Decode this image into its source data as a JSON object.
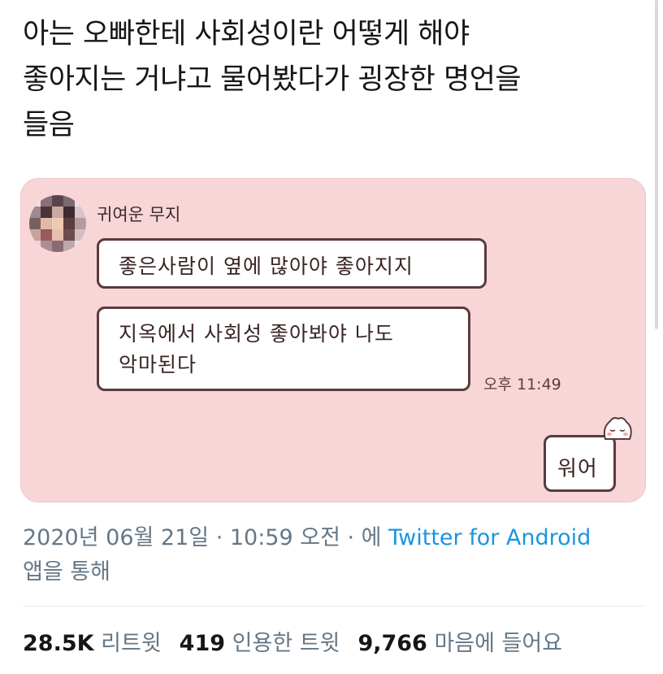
{
  "tweet": {
    "text_line1": "아는 오빠한테 사회성이란 어떻게 해야",
    "text_line2": "좋아지는 거냐고 물어봤다가 굉장한 명언을",
    "text_line3": "들음"
  },
  "chat": {
    "sender_name": "귀여운 무지",
    "message1": "좋은사람이 옆에 많아야 좋아지지",
    "message2_line1": "지옥에서 사회성 좋아봐야 나도",
    "message2_line2": "악마된다",
    "timestamp": "오후 11:49",
    "reply": "워어"
  },
  "meta": {
    "datetime": "2020년 06월 21일 · 10:59 오전 · 에",
    "via_app": "Twitter for Android",
    "via_suffix": "앱을 통해"
  },
  "stats": {
    "retweets_count": "28.5K",
    "retweets_label": "리트윗",
    "quotes_count": "419",
    "quotes_label": "인용한 트윗",
    "likes_count": "9,766",
    "likes_label": "마음에 들어요"
  },
  "colors": {
    "card_background": "#f8d6d8",
    "bubble_border": "#5a3b3b",
    "link": "#1b95e0",
    "secondary_text": "#657786"
  }
}
